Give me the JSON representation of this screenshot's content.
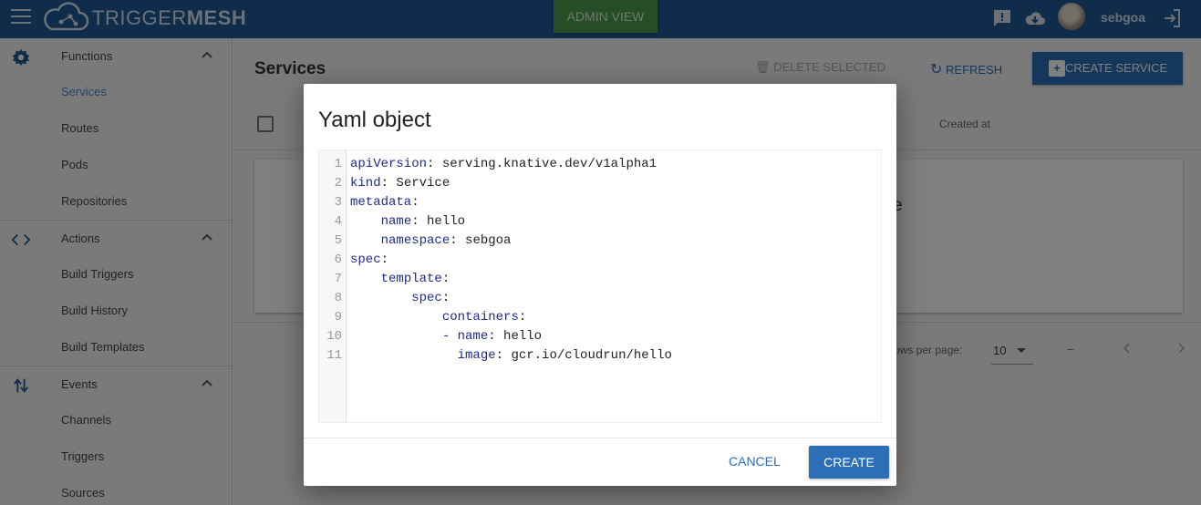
{
  "app": {
    "logo_light": "TRIGGER",
    "logo_bold": "MESH",
    "admin_view_label": "ADMIN VIEW",
    "username": "sebgoa"
  },
  "sidebar": {
    "groups": [
      {
        "label": "Functions",
        "icon": "gear-icon",
        "items": [
          "Services",
          "Routes",
          "Pods",
          "Repositories"
        ]
      },
      {
        "label": "Actions",
        "icon": "code-icon",
        "items": [
          "Build Triggers",
          "Build History",
          "Build Templates"
        ]
      },
      {
        "label": "Events",
        "icon": "swap-vertical-icon",
        "items": [
          "Channels",
          "Triggers",
          "Sources"
        ]
      }
    ],
    "active_item": "Services"
  },
  "main": {
    "title": "Services",
    "delete_selected_label": "DELETE SELECTED",
    "refresh_label": "REFRESH",
    "create_service_label": "CREATE SERVICE",
    "column_created_at": "Created at",
    "card_partial_text": "e",
    "rows_per_page_label": "ows per page:",
    "rows_per_page_value": "10",
    "range_text": "–"
  },
  "dialog": {
    "title": "Yaml object",
    "code_lines": [
      {
        "n": "1",
        "key": "apiVersion",
        "value": " serving.knative.dev/v1alpha1",
        "indent": ""
      },
      {
        "n": "2",
        "key": "kind",
        "value": " Service",
        "indent": ""
      },
      {
        "n": "3",
        "key": "metadata",
        "value": "",
        "indent": ""
      },
      {
        "n": "4",
        "key": "name",
        "value": " hello",
        "indent": "    "
      },
      {
        "n": "5",
        "key": "namespace",
        "value": " sebgoa",
        "indent": "    "
      },
      {
        "n": "6",
        "key": "spec",
        "value": "",
        "indent": ""
      },
      {
        "n": "7",
        "key": "template",
        "value": "",
        "indent": "    "
      },
      {
        "n": "8",
        "key": "spec",
        "value": "",
        "indent": "        "
      },
      {
        "n": "9",
        "key": "containers",
        "value": "",
        "indent": "            "
      },
      {
        "n": "10",
        "key": "- name",
        "value": " hello",
        "indent": "            "
      },
      {
        "n": "11",
        "key": "image",
        "value": " gcr.io/cloudrun/hello",
        "indent": "              "
      }
    ],
    "cancel_label": "CANCEL",
    "create_label": "CREATE"
  },
  "colors": {
    "appbar": "#1e5a96",
    "admin": "#4c9a4c",
    "primary": "#2a6fb8",
    "yaml_key": "#1d2b8a"
  }
}
